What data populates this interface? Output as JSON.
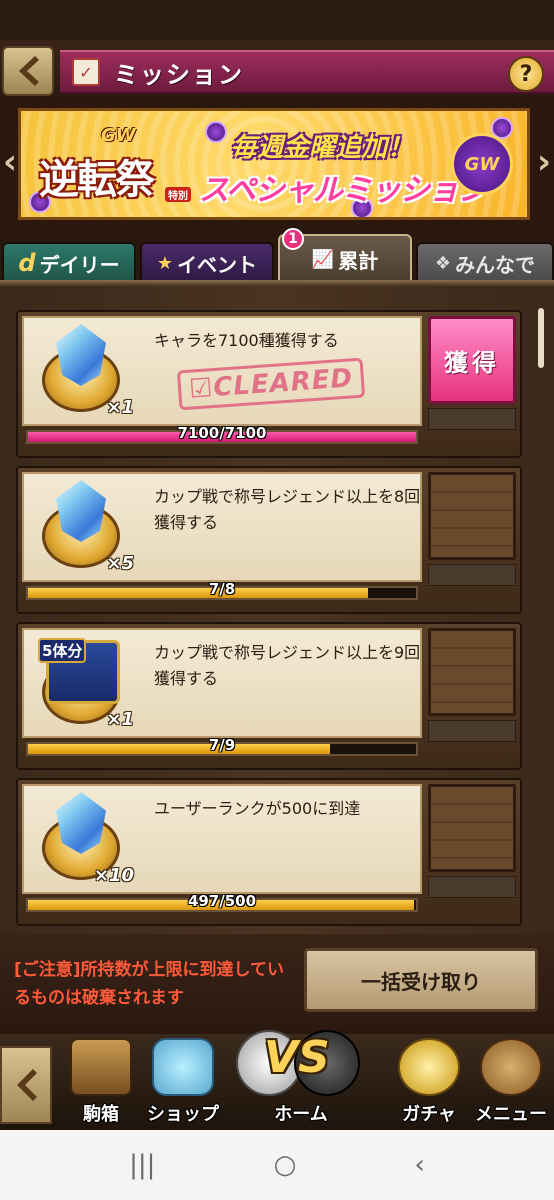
{
  "header": {
    "title": "ミッション",
    "help_label": "?",
    "back_label": "‹"
  },
  "banner": {
    "gw_tag": "GW",
    "title": "逆転祭",
    "title_sub": "特別",
    "line1": "毎週金曜追加！",
    "line2": "スペシャルミッション",
    "coin_label": "GW",
    "prev_label": "‹",
    "next_label": "›"
  },
  "tabs": [
    {
      "label": "デイリー",
      "icon": "d-icon"
    },
    {
      "label": "イベント",
      "icon": "star-icon"
    },
    {
      "label": "累計",
      "icon": "chart-icon",
      "badge": "1",
      "active": true
    },
    {
      "label": "みんなで",
      "icon": "group-icon"
    }
  ],
  "missions": [
    {
      "text": "キャラを7100種獲得する",
      "reward_type": "crystal",
      "qty": "×1",
      "progress_text": "7100/7100",
      "progress": 1.0,
      "status": "CLEARED",
      "claim_label": "獲得"
    },
    {
      "text": "カップ戦で称号レジェンド以上を8回獲得する",
      "reward_type": "crystal",
      "qty": "×5",
      "progress_text": "7/8",
      "progress": 0.875
    },
    {
      "text": "カップ戦で称号レジェンド以上を9回獲得する",
      "reward_type": "box",
      "box_label": "5体分",
      "qty": "×1",
      "progress_text": "7/9",
      "progress": 0.778
    },
    {
      "text": "ユーザーランクが500に到達",
      "reward_type": "crystal",
      "qty": "×10",
      "progress_text": "497/500",
      "progress": 0.994
    }
  ],
  "notice": {
    "text": "[ご注意]所持数が上限に到達しているものは破棄されます",
    "bulk_button": "一括受け取り"
  },
  "bottom_nav": [
    {
      "label": "駒箱",
      "icon": "chest-icon"
    },
    {
      "label": "ショップ",
      "icon": "shop-icon"
    },
    {
      "label": "ホーム",
      "icon": "vs-icon",
      "vs_text": "VS"
    },
    {
      "label": "ガチャ",
      "icon": "coin-icon"
    },
    {
      "label": "メニュー",
      "icon": "gear-icon"
    }
  ],
  "system_nav": {
    "recents": "|||",
    "home": "○",
    "back": "‹"
  },
  "colors": {
    "title_bar": "#9c2d5c",
    "claim_button": "#e8327e",
    "progress_complete": "#d01870",
    "progress_partial": "#d8960a",
    "notice_text": "#ff5a3a"
  }
}
